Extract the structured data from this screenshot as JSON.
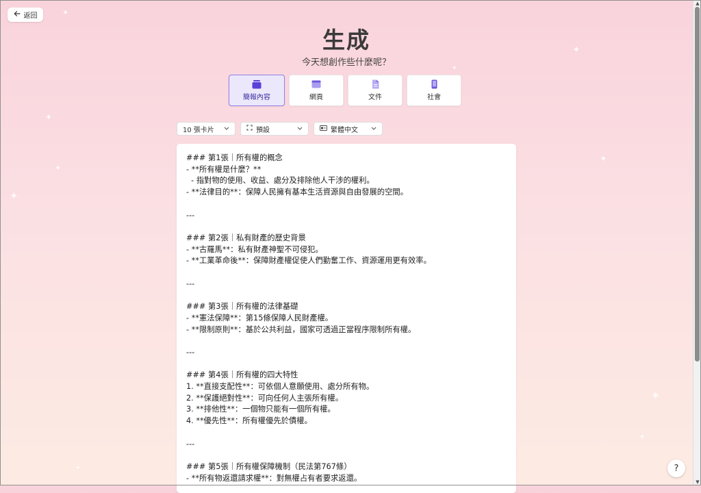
{
  "back": {
    "label": "返回",
    "icon": "arrow-left-icon"
  },
  "title": "生成",
  "subtitle": "今天想創作些什麼呢？",
  "types": [
    {
      "label": "簡報內容",
      "icon": "presentation-icon",
      "active": true
    },
    {
      "label": "網頁",
      "icon": "webpage-icon",
      "active": false
    },
    {
      "label": "文件",
      "icon": "document-icon",
      "active": false
    },
    {
      "label": "社會",
      "icon": "phone-icon",
      "active": false
    }
  ],
  "options": {
    "cards": "10 張卡片",
    "layout": "預設",
    "language": "繁體中文"
  },
  "editor": {
    "text": "### 第1張｜所有權的概念\n- **所有權是什麼？**\n  - 指對物的使用、收益、處分及排除他人干涉的權利。\n- **法律目的**：保障人民擁有基本生活資源與自由發展的空間。\n\n---\n\n### 第2張｜私有財產的歷史背景\n- **古羅馬**：私有財產神聖不可侵犯。\n- **工業革命後**：保障財產權促使人們勤奮工作、資源運用更有效率。\n\n---\n\n### 第3張｜所有權的法律基礎\n- **憲法保障**：第15條保障人民財產權。\n- **限制原則**：基於公共利益，國家可透過正當程序限制所有權。\n\n---\n\n### 第4張｜所有權的四大特性\n1. **直接支配性**：可依個人意願使用、處分所有物。\n2. **保護絕對性**：可向任何人主張所有權。\n3. **排他性**：一個物只能有一個所有權。\n4. **優先性**：所有權優先於債權。\n\n---\n\n### 第5張｜所有權保障機制（民法第767條）\n- **所有物返還請求權**：對無權占有者要求返還。"
  },
  "help": "?",
  "colors": {
    "accent": "#8f7ee6",
    "accent_bg": "#ece8fb",
    "icon_purple": "#5a3fd8"
  }
}
